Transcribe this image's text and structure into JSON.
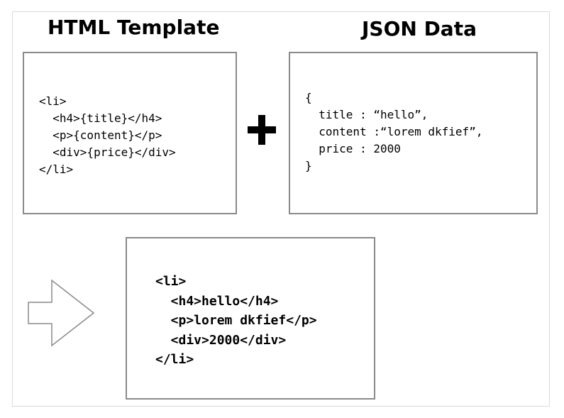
{
  "headings": {
    "template": "HTML Template",
    "json": "JSON Data"
  },
  "template_code": [
    "<li>",
    "  <h4>{title}</h4>",
    "  <p>{content}</p>",
    "  <div>{price}</div>",
    "</li>"
  ],
  "json_code": [
    "{",
    "  title : “hello”,",
    "  content :“lorem dkfief”,",
    "  price : 2000",
    "}"
  ],
  "result_code": [
    "<li>",
    "  <h4>hello</h4>",
    "  <p>lorem dkfief</p>",
    "  <div>2000</div>",
    "</li>"
  ],
  "icons": {
    "plus": "plus-icon",
    "arrow": "right-arrow-icon"
  },
  "colors": {
    "box_border": "#8a8a8a",
    "text": "#000000",
    "frame_border": "#d9d9d9"
  }
}
